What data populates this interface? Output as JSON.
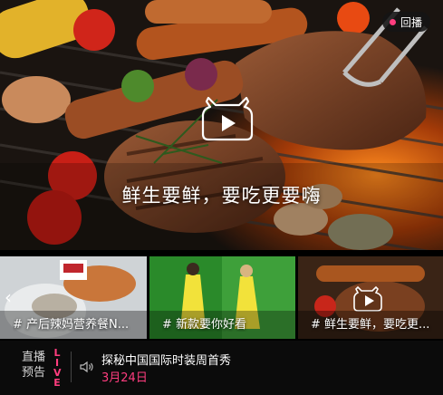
{
  "hero": {
    "badge_label": "回播",
    "title": "鲜生要鲜，要吃更要嗨",
    "play_icon": "play-icon"
  },
  "thumbnails": [
    {
      "caption": "# 产后辣妈营养餐N..."
    },
    {
      "caption": "# 新款要你好看"
    },
    {
      "caption": "# 鲜生要鲜，要吃更..."
    }
  ],
  "live_bar": {
    "label_line1": "直播",
    "label_line2": "预告",
    "label_en": "LIVE",
    "title": "探秘中国国际时装周首秀",
    "date": "3月24日"
  },
  "colors": {
    "accent": "#ff3d7f",
    "background": "#000000"
  }
}
